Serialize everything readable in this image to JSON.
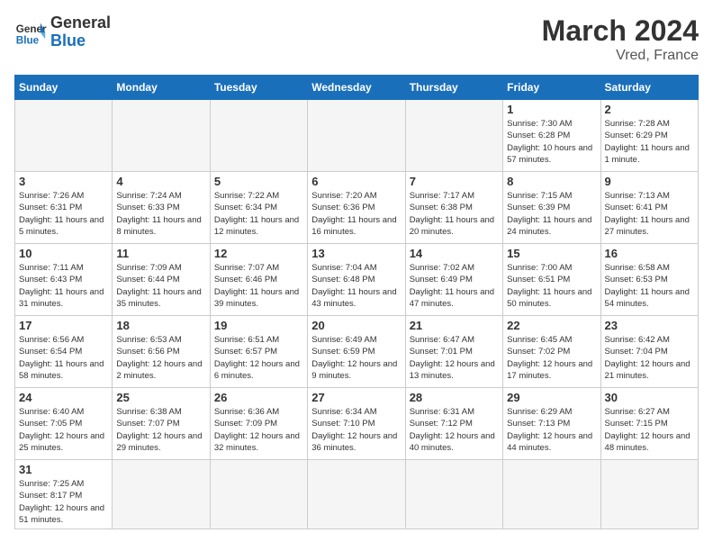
{
  "header": {
    "logo_general": "General",
    "logo_blue": "Blue",
    "title": "March 2024",
    "location": "Vred, France"
  },
  "weekdays": [
    "Sunday",
    "Monday",
    "Tuesday",
    "Wednesday",
    "Thursday",
    "Friday",
    "Saturday"
  ],
  "weeks": [
    [
      {
        "day": "",
        "info": ""
      },
      {
        "day": "",
        "info": ""
      },
      {
        "day": "",
        "info": ""
      },
      {
        "day": "",
        "info": ""
      },
      {
        "day": "",
        "info": ""
      },
      {
        "day": "1",
        "info": "Sunrise: 7:30 AM\nSunset: 6:28 PM\nDaylight: 10 hours and 57 minutes."
      },
      {
        "day": "2",
        "info": "Sunrise: 7:28 AM\nSunset: 6:29 PM\nDaylight: 11 hours and 1 minute."
      }
    ],
    [
      {
        "day": "3",
        "info": "Sunrise: 7:26 AM\nSunset: 6:31 PM\nDaylight: 11 hours and 5 minutes."
      },
      {
        "day": "4",
        "info": "Sunrise: 7:24 AM\nSunset: 6:33 PM\nDaylight: 11 hours and 8 minutes."
      },
      {
        "day": "5",
        "info": "Sunrise: 7:22 AM\nSunset: 6:34 PM\nDaylight: 11 hours and 12 minutes."
      },
      {
        "day": "6",
        "info": "Sunrise: 7:20 AM\nSunset: 6:36 PM\nDaylight: 11 hours and 16 minutes."
      },
      {
        "day": "7",
        "info": "Sunrise: 7:17 AM\nSunset: 6:38 PM\nDaylight: 11 hours and 20 minutes."
      },
      {
        "day": "8",
        "info": "Sunrise: 7:15 AM\nSunset: 6:39 PM\nDaylight: 11 hours and 24 minutes."
      },
      {
        "day": "9",
        "info": "Sunrise: 7:13 AM\nSunset: 6:41 PM\nDaylight: 11 hours and 27 minutes."
      }
    ],
    [
      {
        "day": "10",
        "info": "Sunrise: 7:11 AM\nSunset: 6:43 PM\nDaylight: 11 hours and 31 minutes."
      },
      {
        "day": "11",
        "info": "Sunrise: 7:09 AM\nSunset: 6:44 PM\nDaylight: 11 hours and 35 minutes."
      },
      {
        "day": "12",
        "info": "Sunrise: 7:07 AM\nSunset: 6:46 PM\nDaylight: 11 hours and 39 minutes."
      },
      {
        "day": "13",
        "info": "Sunrise: 7:04 AM\nSunset: 6:48 PM\nDaylight: 11 hours and 43 minutes."
      },
      {
        "day": "14",
        "info": "Sunrise: 7:02 AM\nSunset: 6:49 PM\nDaylight: 11 hours and 47 minutes."
      },
      {
        "day": "15",
        "info": "Sunrise: 7:00 AM\nSunset: 6:51 PM\nDaylight: 11 hours and 50 minutes."
      },
      {
        "day": "16",
        "info": "Sunrise: 6:58 AM\nSunset: 6:53 PM\nDaylight: 11 hours and 54 minutes."
      }
    ],
    [
      {
        "day": "17",
        "info": "Sunrise: 6:56 AM\nSunset: 6:54 PM\nDaylight: 11 hours and 58 minutes."
      },
      {
        "day": "18",
        "info": "Sunrise: 6:53 AM\nSunset: 6:56 PM\nDaylight: 12 hours and 2 minutes."
      },
      {
        "day": "19",
        "info": "Sunrise: 6:51 AM\nSunset: 6:57 PM\nDaylight: 12 hours and 6 minutes."
      },
      {
        "day": "20",
        "info": "Sunrise: 6:49 AM\nSunset: 6:59 PM\nDaylight: 12 hours and 9 minutes."
      },
      {
        "day": "21",
        "info": "Sunrise: 6:47 AM\nSunset: 7:01 PM\nDaylight: 12 hours and 13 minutes."
      },
      {
        "day": "22",
        "info": "Sunrise: 6:45 AM\nSunset: 7:02 PM\nDaylight: 12 hours and 17 minutes."
      },
      {
        "day": "23",
        "info": "Sunrise: 6:42 AM\nSunset: 7:04 PM\nDaylight: 12 hours and 21 minutes."
      }
    ],
    [
      {
        "day": "24",
        "info": "Sunrise: 6:40 AM\nSunset: 7:05 PM\nDaylight: 12 hours and 25 minutes."
      },
      {
        "day": "25",
        "info": "Sunrise: 6:38 AM\nSunset: 7:07 PM\nDaylight: 12 hours and 29 minutes."
      },
      {
        "day": "26",
        "info": "Sunrise: 6:36 AM\nSunset: 7:09 PM\nDaylight: 12 hours and 32 minutes."
      },
      {
        "day": "27",
        "info": "Sunrise: 6:34 AM\nSunset: 7:10 PM\nDaylight: 12 hours and 36 minutes."
      },
      {
        "day": "28",
        "info": "Sunrise: 6:31 AM\nSunset: 7:12 PM\nDaylight: 12 hours and 40 minutes."
      },
      {
        "day": "29",
        "info": "Sunrise: 6:29 AM\nSunset: 7:13 PM\nDaylight: 12 hours and 44 minutes."
      },
      {
        "day": "30",
        "info": "Sunrise: 6:27 AM\nSunset: 7:15 PM\nDaylight: 12 hours and 48 minutes."
      }
    ],
    [
      {
        "day": "31",
        "info": "Sunrise: 7:25 AM\nSunset: 8:17 PM\nDaylight: 12 hours and 51 minutes."
      },
      {
        "day": "",
        "info": ""
      },
      {
        "day": "",
        "info": ""
      },
      {
        "day": "",
        "info": ""
      },
      {
        "day": "",
        "info": ""
      },
      {
        "day": "",
        "info": ""
      },
      {
        "day": "",
        "info": ""
      }
    ]
  ]
}
